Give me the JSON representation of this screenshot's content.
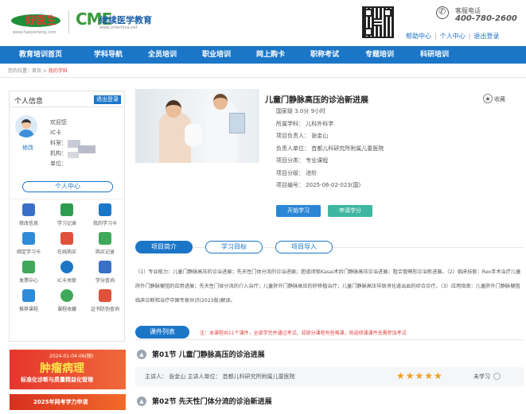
{
  "header": {
    "logo1_text": "好医生",
    "logo1_url": "www.haoyisheng.com",
    "logo2_mark": "CME",
    "logo2_name": "继续医学教育",
    "logo2_url": "www.cmechina.net",
    "hotline_label": "客服电话",
    "hotline_number": "400-780-2600",
    "links": [
      "帮助中心",
      "个人中心",
      "退出登录"
    ]
  },
  "nav": {
    "items": [
      "教育培训首页",
      "学科导航",
      "全员培训",
      "职业培训",
      "网上购卡",
      "职称考试",
      "专题培训",
      "科研培训"
    ]
  },
  "breadcrumb": {
    "prefix": "您的位置：首页 > ",
    "current": "我的学科"
  },
  "sidebar": {
    "title": "个人信息",
    "logout": "退出登录",
    "edit": "修改",
    "welcome": "欢迎您",
    "ic_label": "IC卡",
    "dept_label": "科室：",
    "org_label": "机构：",
    "unit_label": "单位：",
    "center_button": "个人中心",
    "grid": [
      {
        "label": "修改信息",
        "icon": "edit-icon",
        "color": "#3a6fc8"
      },
      {
        "label": "学习记录",
        "icon": "bookmark-icon",
        "color": "#2e9b4f"
      },
      {
        "label": "我的学习卡",
        "icon": "card-icon",
        "color": "#1b76c8"
      },
      {
        "label": "绑定学习卡",
        "icon": "bind-card-icon",
        "color": "#2f8ad8"
      },
      {
        "label": "在线购买",
        "icon": "cart-icon",
        "color": "#e0513b"
      },
      {
        "label": "购买记录",
        "icon": "receipt-icon",
        "color": "#3fa85a"
      },
      {
        "label": "发票中心",
        "icon": "invoice-icon",
        "color": "#3fa85a"
      },
      {
        "label": "IC卡关联",
        "icon": "link-icon",
        "color": "#1b76c8"
      },
      {
        "label": "学分查询",
        "icon": "monitor-icon",
        "color": "#3a6fc8"
      },
      {
        "label": "推荐课程",
        "icon": "book-icon",
        "color": "#2f8ad8"
      },
      {
        "label": "课程收藏",
        "icon": "star-icon",
        "color": "#3fa85a"
      },
      {
        "label": "证书防伪查询",
        "icon": "shield-icon",
        "color": "#e0513b"
      }
    ]
  },
  "course": {
    "title": "儿童门静脉高压的诊治新进展",
    "favorite": "收藏",
    "meta": [
      "国家级  3.0分  9小时",
      "所属学科：  儿科外科学",
      "项目负责人：  张金山",
      "负责人单位：  首都儿科研究所附属儿童医院",
      "项目分类：  专业课程",
      "项目分级：  进阶",
      "项目编号：  2025-06-02-023(国)"
    ],
    "start_button": "开始学习",
    "apply_button": "申请学分"
  },
  "tabs": [
    "项目简介",
    "学习目标",
    "项目导入"
  ],
  "intro": "（1）专业能力：儿童门静脉高压的诊治进展；先天性门体分流的诊治进展；胆道闭锁Kasai术后门静脉高压诊治进展；阻合管畸形诊治新进展。（2）临床技能：Rex手术治疗儿童肝外门静脉梗阻的应用进展；先天性门体分流的介入治疗；儿童肝外门静脉高压的肝移植治疗；儿童门静脉高压导致消化道出血的综合诊疗。（3）应用指南：儿童肝外门静脉梗阻临床诊断和治疗中国专家共识(2023版)解读。",
  "course_list": {
    "tab": "课件列表",
    "notice": "注：本课程共11个课件，全部学完并通过考试，却部分课程有些难课，则选修课课件无需参加考试",
    "lessons": [
      {
        "title": "第01节 儿童门静脉高压的诊治进展",
        "speaker": "主讲人：  张金山    主讲人单位：  首都儿科研究所附属儿童医院",
        "stars": "★★★★★",
        "status": "未学习"
      },
      {
        "title": "第02节 先天性门体分流的诊治新进展"
      }
    ]
  },
  "banners": {
    "b1_date": "2024-01-04-06(随)",
    "b1_big": "肿瘤病理",
    "b1_sub": "标准化诊断与质量精益化管理",
    "b2_text": "2025年网考学力申请"
  }
}
